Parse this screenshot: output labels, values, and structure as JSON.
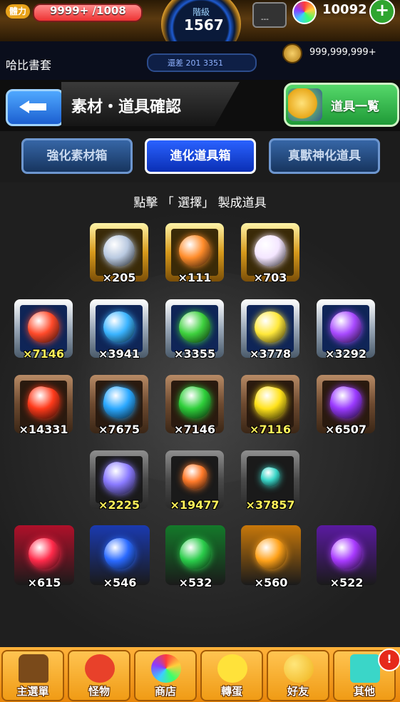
{
  "status": {
    "stamina_label": "體力",
    "stamina_value": "9999+ /1008",
    "rank_label": "階級",
    "rank_value": "1567",
    "next_rank_text": "還差 201 3351",
    "item_box_text": "---",
    "orb_count": "10092",
    "plus": "+",
    "player_name": "哈比書套",
    "coin_count": "999,999,999+"
  },
  "header": {
    "title": "素材・道具確認",
    "item_list_label": "道具一覧"
  },
  "tabs": [
    {
      "label": "強化素材箱",
      "active": false
    },
    {
      "label": "進化道具箱",
      "active": true
    },
    {
      "label": "真獸神化道具",
      "active": false
    }
  ],
  "instruction": "點擊 「 選擇」 製成道具",
  "rows": {
    "gold": [
      {
        "count": "×205",
        "icon": "silver-crest-icon",
        "color": "#b9c9e0"
      },
      {
        "count": "×111",
        "icon": "rainbow-nine-icon",
        "color": "#ff8c2a"
      },
      {
        "count": "×703",
        "icon": "rainbow-pearl-icon",
        "color": "#f4e6ff"
      }
    ],
    "silver": [
      {
        "count": "×7146",
        "icon": "fire-orb-icon",
        "color": "#ff4a2a"
      },
      {
        "count": "×3941",
        "icon": "water-orb-icon",
        "color": "#3ab4ff"
      },
      {
        "count": "×3355",
        "icon": "wood-orb-icon",
        "color": "#3ed13e"
      },
      {
        "count": "×3778",
        "icon": "light-orb-icon",
        "color": "#ffe83a"
      },
      {
        "count": "×3292",
        "icon": "dark-orb-icon",
        "color": "#a84aff"
      }
    ],
    "bronze": [
      {
        "count": "×14331",
        "icon": "fire-crystal-icon",
        "color": "#ff3a1a"
      },
      {
        "count": "×7675",
        "icon": "water-crystal-icon",
        "color": "#2aa8ff"
      },
      {
        "count": "×7146",
        "icon": "wood-crystal-icon",
        "color": "#2ecf3a"
      },
      {
        "count": "×7116",
        "icon": "light-crystal-icon",
        "color": "#ffe21a"
      },
      {
        "count": "×6507",
        "icon": "dark-crystal-icon",
        "color": "#9a3aff"
      }
    ],
    "iron": [
      {
        "count": "×2225",
        "icon": "rainbow-crystal-icon",
        "color": "#8a7aff"
      },
      {
        "count": "×19477",
        "icon": "orange-shard-icon",
        "color": "#ff7a2a"
      },
      {
        "count": "×37857",
        "icon": "teal-shard-icon",
        "color": "#3ad6c8"
      }
    ],
    "dragons": [
      {
        "count": "×615",
        "icon": "fire-dragon-orb-icon",
        "color": "#ff2a4a",
        "bg": "#b0102a"
      },
      {
        "count": "×546",
        "icon": "water-dragon-orb-icon",
        "color": "#2a6aff",
        "bg": "#1a3ab0"
      },
      {
        "count": "×532",
        "icon": "wood-dragon-orb-icon",
        "color": "#2acc4a",
        "bg": "#147a2a"
      },
      {
        "count": "×560",
        "icon": "light-dragon-orb-icon",
        "color": "#ffa21a",
        "bg": "#c8780a"
      },
      {
        "count": "×522",
        "icon": "dark-dragon-orb-icon",
        "color": "#a83aff",
        "bg": "#5a1aa0"
      }
    ]
  },
  "nav": [
    {
      "label": "主選單",
      "icon": "castle-icon"
    },
    {
      "label": "怪物",
      "icon": "monster-icon"
    },
    {
      "label": "商店",
      "icon": "rainbow-orb-icon"
    },
    {
      "label": "轉蛋",
      "icon": "egg-icon"
    },
    {
      "label": "好友",
      "icon": "balloons-icon"
    },
    {
      "label": "其他",
      "icon": "other-icon"
    }
  ],
  "nav_badge": "!"
}
